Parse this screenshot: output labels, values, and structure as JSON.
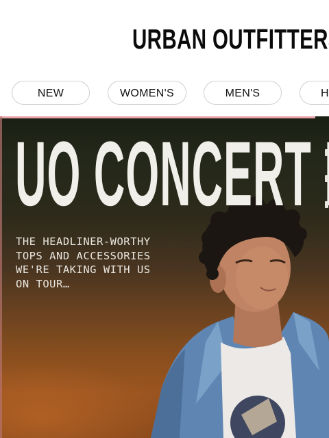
{
  "header": {
    "logo_text": "URBAN OUTFITTERS"
  },
  "nav": {
    "items": [
      {
        "label": "NEW"
      },
      {
        "label": "WOMEN'S"
      },
      {
        "label": "MEN'S"
      },
      {
        "label": "H"
      }
    ]
  },
  "hero": {
    "title": "UO CONCERT FITS",
    "subtitle": "THE HEADLINER-WORTHY\nTOPS AND ACCESSORIES\nWE'RE TAKING WITH US\nON TOUR…",
    "colors": {
      "title": "#f1efe9",
      "background_top": "#1a1f14",
      "background_bottom": "#9a5420",
      "accent_strip": "#e7a3a8"
    }
  }
}
